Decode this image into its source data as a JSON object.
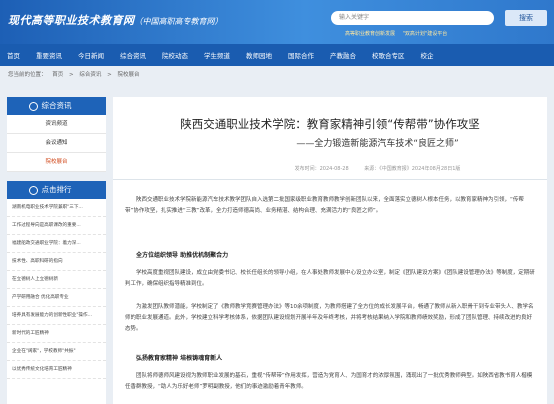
{
  "header": {
    "logo": "现代高等职业技术教育网",
    "logo_sub": "（中国高职高专教育网）",
    "search_placeholder": "输入关键字",
    "search_button": "搜索",
    "links": [
      "高等职业教育创新发展",
      "\"双高计划\"建设平台"
    ]
  },
  "nav": [
    "首页",
    "重要资讯",
    "今日新闻",
    "综合资讯",
    "院校动态",
    "学生频道",
    "教师园地",
    "国际合作",
    "产教融合",
    "校歌合专区",
    "校企"
  ],
  "breadcrumb": [
    "您当前的位置：",
    "首页",
    ">",
    "综合资讯",
    ">",
    "院校展台"
  ],
  "sidebar": {
    "section1_title": "综合资讯",
    "items": [
      "资讯频道",
      "会议通知",
      "院校展台"
    ],
    "active_index": 2,
    "section2_title": "点击排行",
    "hot": [
      "湖南机电职业技术学院兼职\"三下...",
      "工作过程导向是高职课改的重要...",
      "福建船政交通职业学院：着力深...",
      "技术性、高职科研的指向",
      "在立德树人上立德树新",
      "产学研用融合 优化高职专业",
      "培养具有发展能力的创新性职业\"操作...",
      "新时代的工匠精神",
      "企业在\"阔家\"，学校教师\"共振\"",
      "以优秀传统文化培育工匠精神"
    ]
  },
  "article": {
    "title": "陕西交通职业技术学院：教育家精神引领“传帮带”协作攻坚",
    "subtitle": "——全力锻造新能源汽车技术“良匠之师”",
    "source": "发布时间：2024-08-28",
    "origin": "来源：《中国教育报》2024年08月28日1版",
    "p1": "陕西交通职业技术学院新能源汽车技术教学团队自入选第二批国家级职业教育教师教学创新团队以来，全面落实立德树人根本任务，以教育家精神为引领，“传帮带”协作攻坚，扎实推进“三教”改革，全力打造师德高尚、业务精湛、结构合理、充满活力的“良匠之师”。",
    "h1": "全方位组织领导  助推优机制聚合力",
    "p2": "学校高度重视团队建设，成立由党委书记、校长任组长的领导小组，在人事处教师发展中心设立办公室，制定《团队建设方案》《团队建设管理办法》等制度，定期研判工作，确保组织指导精准到位。",
    "p3": "为激发团队教师潜能，学校制定了《教师教学竞赛管理办法》等10余项制度，为教师搭建了全方位的成长发展平台，畅通了教师从新入职骨干到专业带头人、教学名师的职业发展通道。此外，学校建立科学考核体系，依据团队建设规划开展半年及年终考核，并将考核结果纳入学院和教师绩效奖励，形成了团队管理、持续改进的良好态势。",
    "h2": "弘扬教育家精神  培根铸魂育新人",
    "p4": "团队将师德师风建设视为教师职业发展的基石，重视“传帮带”作用发挥，营造为党育人、为国育才的浓厚氛围，涌现出了一批优秀教师典型。如陕西省教书育人楷模任香群教授，“助人为乐好老师”罗明副教授，他们的事迹激励着青年教师。"
  }
}
